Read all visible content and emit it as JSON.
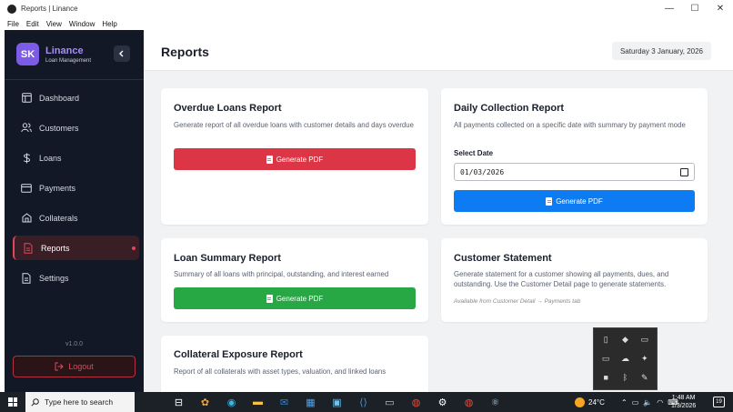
{
  "window": {
    "title": "Reports | Linance",
    "minimize": "—",
    "maximize": "☐",
    "close": "✕"
  },
  "menu": [
    "File",
    "Edit",
    "View",
    "Window",
    "Help"
  ],
  "sidebar": {
    "logo_initials": "SK",
    "app_name": "Linance",
    "app_subtitle": "Loan Management",
    "collapse_icon": "chevron-left-icon",
    "items": [
      {
        "label": "Dashboard",
        "icon": "layout-icon",
        "active": false
      },
      {
        "label": "Customers",
        "icon": "users-icon",
        "active": false
      },
      {
        "label": "Loans",
        "icon": "dollar-icon",
        "active": false
      },
      {
        "label": "Payments",
        "icon": "credit-card-icon",
        "active": false
      },
      {
        "label": "Collaterals",
        "icon": "home-icon",
        "active": false
      },
      {
        "label": "Reports",
        "icon": "file-text-icon",
        "active": true
      },
      {
        "label": "Settings",
        "icon": "file-icon",
        "active": false
      }
    ],
    "version": "v1.0.0",
    "logout_label": "Logout"
  },
  "header": {
    "title": "Reports",
    "date": "Saturday 3 January, 2026"
  },
  "cards": {
    "overdue": {
      "title": "Overdue Loans Report",
      "description": "Generate report of all overdue loans with customer details and days overdue",
      "button": "Generate PDF"
    },
    "daily": {
      "title": "Daily Collection Report",
      "description": "All payments collected on a specific date with summary by payment mode",
      "date_label": "Select Date",
      "date_value": "01/03/2026",
      "button": "Generate PDF"
    },
    "summary": {
      "title": "Loan Summary Report",
      "description": "Summary of all loans with principal, outstanding, and interest earned",
      "button": "Generate PDF"
    },
    "statement": {
      "title": "Customer Statement",
      "description": "Generate statement for a customer showing all payments, dues, and outstanding. Use the Customer Detail page to generate statements.",
      "note": "Available from Customer Detail → Payments tab"
    },
    "collateral": {
      "title": "Collateral Exposure Report",
      "description": "Report of all collaterals with asset types, valuation, and linked loans"
    }
  },
  "colors": {
    "accent_red": "#dc3545",
    "accent_blue": "#0d7cf2",
    "accent_green": "#28a745",
    "sidebar_bg": "#121826",
    "brand_purple": "#7c5ce6"
  },
  "taskbar": {
    "search_placeholder": "Type here to search",
    "weather": "24°C",
    "time": "1:48 AM",
    "date": "1/3/2026",
    "notifications": "19"
  }
}
